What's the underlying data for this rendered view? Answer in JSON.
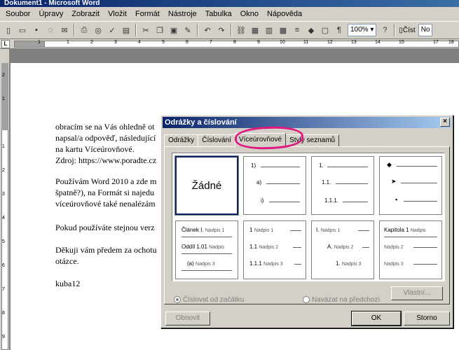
{
  "window": {
    "title": "Dokument1 - Microsoft Word"
  },
  "menu": [
    "Soubor",
    "Úpravy",
    "Zobrazit",
    "Vložit",
    "Formát",
    "Nástroje",
    "Tabulka",
    "Okno",
    "Nápověda"
  ],
  "toolbar": {
    "zoom": "100%",
    "read_label": "Číst",
    "style_label": "No"
  },
  "ruler": {
    "corner": "L",
    "numbers": [
      "1",
      "1",
      "2",
      "3",
      "4",
      "5",
      "6",
      "7",
      "8",
      "9",
      "10",
      "11",
      "12",
      "13",
      "14",
      "15",
      "17",
      "18"
    ]
  },
  "vruler": {
    "numbers": [
      "2",
      "1",
      "1",
      "2",
      "3",
      "4",
      "5",
      "6",
      "7",
      "8",
      "9"
    ]
  },
  "document": {
    "lines": [
      "obracím se na Vás ohledně ot",
      "napsal/a odpověď, následující",
      "na kartu Víceúrovňové.",
      "Zdroj: https://www.poradte.cz",
      "Používám Word 2010 a zde m",
      "špatně?), na Formát si najedu",
      "víceúrovňové také nenalézám",
      "Pokud používáte stejnou verz",
      "Děkuji vám předem za ochotu",
      "otázce.",
      "kuba12"
    ]
  },
  "dialog": {
    "title": "Odrážky a číslování",
    "close": "×",
    "tabs": [
      "Odrážky",
      "Číslování",
      "Víceúrovňové",
      "Styly seznamů"
    ],
    "active_tab": "Víceúrovňové",
    "cells": {
      "none": "Žádné",
      "c2": [
        "1)",
        "a)",
        "i)"
      ],
      "c3": [
        "1.",
        "1.1.",
        "1.1.1."
      ],
      "c4": [
        "◆",
        "➤",
        "▪"
      ],
      "c5": {
        "l1a": "Článek I.",
        "l1b": "Nadpis 1",
        "l2a": "Oddíl 1.01",
        "l2b": "Nadpis",
        "l3a": "(a)",
        "l3b": "Nadpis 3"
      },
      "c6": {
        "l1a": "1",
        "l1b": "Nadpis 1",
        "l2a": "1.1",
        "l2b": "Nadpis 2",
        "l3a": "1.1.1",
        "l3b": "Nadpis 3"
      },
      "c7": {
        "l1a": "I.",
        "l1b": "Nadpis 1",
        "l2a": "A.",
        "l2b": "Nadpis 2",
        "l3a": "1.",
        "l3b": "Nadpis 3"
      },
      "c8": {
        "l1a": "Kapitola 1",
        "l1b": "Nadpis",
        "l2b": "Nadpis 2",
        "l3b": "Nadpis 3"
      }
    },
    "radio_restart": "Číslovat od začátku",
    "radio_continue": "Navázat na předchozí",
    "buttons": {
      "custom": "Vlastní...",
      "reset": "Obnovit",
      "ok": "OK",
      "cancel": "Storno"
    }
  }
}
